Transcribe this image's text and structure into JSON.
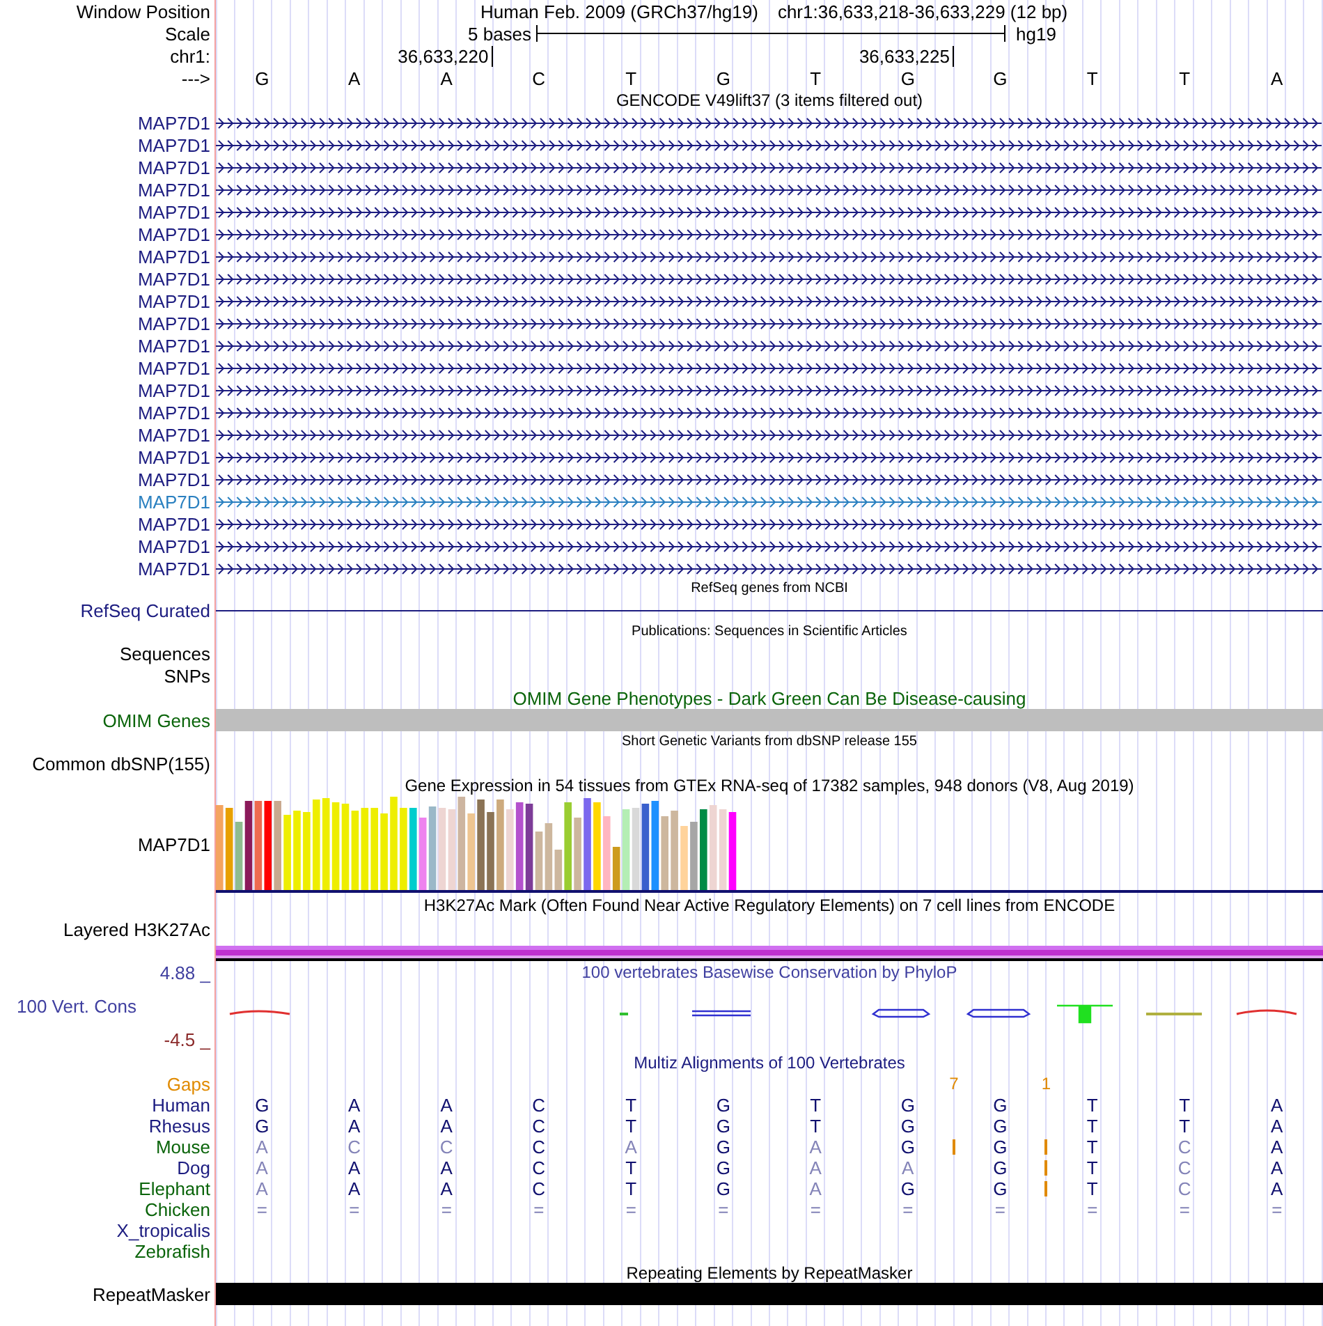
{
  "header": {
    "labels": [
      "Window Position",
      "Scale",
      "chr1:",
      "--->"
    ],
    "assembly": "Human Feb. 2009 (GRCh37/hg19)",
    "position": "chr1:36,633,218-36,633,229 (12 bp)",
    "scale_label": "5 bases",
    "scale_db": "hg19",
    "ticks": [
      "36,633,220",
      "36,633,225"
    ],
    "bases": [
      "G",
      "A",
      "A",
      "C",
      "T",
      "G",
      "T",
      "G",
      "G",
      "T",
      "T",
      "A"
    ]
  },
  "tracks": [
    {
      "kind": "gencode",
      "title": "GENCODE V49lift37 (3 items filtered out)",
      "rows": [
        {
          "label": "MAP7D1",
          "color": "#1c1c80"
        },
        {
          "label": "MAP7D1",
          "color": "#1c1c80"
        },
        {
          "label": "MAP7D1",
          "color": "#1c1c80"
        },
        {
          "label": "MAP7D1",
          "color": "#1c1c80"
        },
        {
          "label": "MAP7D1",
          "color": "#1c1c80"
        },
        {
          "label": "MAP7D1",
          "color": "#1c1c80"
        },
        {
          "label": "MAP7D1",
          "color": "#1c1c80"
        },
        {
          "label": "MAP7D1",
          "color": "#1c1c80"
        },
        {
          "label": "MAP7D1",
          "color": "#1c1c80"
        },
        {
          "label": "MAP7D1",
          "color": "#1c1c80"
        },
        {
          "label": "MAP7D1",
          "color": "#1c1c80"
        },
        {
          "label": "MAP7D1",
          "color": "#1c1c80"
        },
        {
          "label": "MAP7D1",
          "color": "#1c1c80"
        },
        {
          "label": "MAP7D1",
          "color": "#1c1c80"
        },
        {
          "label": "MAP7D1",
          "color": "#1c1c80"
        },
        {
          "label": "MAP7D1",
          "color": "#1c1c80"
        },
        {
          "label": "MAP7D1",
          "color": "#1c1c80"
        },
        {
          "label": "MAP7D1",
          "color": "#2a80c0"
        },
        {
          "label": "MAP7D1",
          "color": "#1c1c80"
        },
        {
          "label": "MAP7D1",
          "color": "#1c1c80"
        },
        {
          "label": "MAP7D1",
          "color": "#1c1c80"
        }
      ]
    },
    {
      "kind": "refseq",
      "title": "RefSeq genes from NCBI",
      "label": "RefSeq Curated"
    },
    {
      "kind": "publications",
      "title": "Publications: Sequences in Scientific Articles",
      "labels": [
        "Sequences",
        "SNPs"
      ]
    },
    {
      "kind": "omim",
      "title": "OMIM Gene Phenotypes - Dark Green Can Be Disease-causing",
      "label": "OMIM Genes"
    },
    {
      "kind": "dbsnp",
      "title": "Short Genetic Variants from dbSNP release 155",
      "label": "Common dbSNP(155)"
    },
    {
      "kind": "gtex",
      "title": "Gene Expression in 54 tissues from GTEx RNA-seq of 17382 samples, 948 donors (V8, Aug 2019)",
      "label": "MAP7D1"
    },
    {
      "kind": "h3k27ac",
      "title": "H3K27Ac Mark (Often Found Near Active Regulatory Elements) on 7 cell lines from ENCODE",
      "label": "Layered H3K27Ac"
    },
    {
      "kind": "phylop",
      "title": "100 vertebrates Basewise Conservation by PhyloP",
      "label": "100 Vert. Cons",
      "max_label": "4.88 _",
      "min_label": "-4.5 _"
    },
    {
      "kind": "multiz",
      "title": "Multiz Alignments of 100 Vertebrates",
      "gaps_label": "Gaps",
      "gaps": [
        {
          "count": "7"
        },
        {
          "count": "1"
        }
      ],
      "species": [
        {
          "name": "Human",
          "color": "#1c1c80",
          "bases": [
            {
              "base": "G",
              "match": true,
              "insert_after": false
            },
            {
              "base": "A",
              "match": true,
              "insert_after": false
            },
            {
              "base": "A",
              "match": true,
              "insert_after": false
            },
            {
              "base": "C",
              "match": true,
              "insert_after": false
            },
            {
              "base": "T",
              "match": true,
              "insert_after": false
            },
            {
              "base": "G",
              "match": true,
              "insert_after": false
            },
            {
              "base": "T",
              "match": true,
              "insert_after": false
            },
            {
              "base": "G",
              "match": true,
              "insert_after": false
            },
            {
              "base": "G",
              "match": true,
              "insert_after": false
            },
            {
              "base": "T",
              "match": true,
              "insert_after": false
            },
            {
              "base": "T",
              "match": true,
              "insert_after": false
            },
            {
              "base": "A",
              "match": true,
              "insert_after": false
            }
          ]
        },
        {
          "name": "Rhesus",
          "color": "#1c1c80",
          "bases": [
            {
              "base": "G",
              "match": true,
              "insert_after": false
            },
            {
              "base": "A",
              "match": true,
              "insert_after": false
            },
            {
              "base": "A",
              "match": true,
              "insert_after": false
            },
            {
              "base": "C",
              "match": true,
              "insert_after": false
            },
            {
              "base": "T",
              "match": true,
              "insert_after": false
            },
            {
              "base": "G",
              "match": true,
              "insert_after": false
            },
            {
              "base": "T",
              "match": true,
              "insert_after": false
            },
            {
              "base": "G",
              "match": true,
              "insert_after": false
            },
            {
              "base": "G",
              "match": true,
              "insert_after": false
            },
            {
              "base": "T",
              "match": true,
              "insert_after": false
            },
            {
              "base": "T",
              "match": true,
              "insert_after": false
            },
            {
              "base": "A",
              "match": true,
              "insert_after": false
            }
          ]
        },
        {
          "name": "Mouse",
          "color": "#0a640a",
          "bases": [
            {
              "base": "A",
              "match": false,
              "insert_after": false
            },
            {
              "base": "C",
              "match": false,
              "insert_after": false
            },
            {
              "base": "C",
              "match": false,
              "insert_after": false
            },
            {
              "base": "C",
              "match": true,
              "insert_after": false
            },
            {
              "base": "A",
              "match": false,
              "insert_after": false
            },
            {
              "base": "G",
              "match": true,
              "insert_after": false
            },
            {
              "base": "A",
              "match": false,
              "insert_after": false
            },
            {
              "base": "G",
              "match": true,
              "insert_after": true
            },
            {
              "base": "G",
              "match": true,
              "insert_after": true
            },
            {
              "base": "T",
              "match": true,
              "insert_after": false
            },
            {
              "base": "C",
              "match": false,
              "insert_after": false
            },
            {
              "base": "A",
              "match": true,
              "insert_after": false
            }
          ]
        },
        {
          "name": "Dog",
          "color": "#1c1c80",
          "bases": [
            {
              "base": "A",
              "match": false,
              "insert_after": false
            },
            {
              "base": "A",
              "match": true,
              "insert_after": false
            },
            {
              "base": "A",
              "match": true,
              "insert_after": false
            },
            {
              "base": "C",
              "match": true,
              "insert_after": false
            },
            {
              "base": "T",
              "match": true,
              "insert_after": false
            },
            {
              "base": "G",
              "match": true,
              "insert_after": false
            },
            {
              "base": "A",
              "match": false,
              "insert_after": false
            },
            {
              "base": "A",
              "match": false,
              "insert_after": false
            },
            {
              "base": "G",
              "match": true,
              "insert_after": true
            },
            {
              "base": "T",
              "match": true,
              "insert_after": false
            },
            {
              "base": "C",
              "match": false,
              "insert_after": false
            },
            {
              "base": "A",
              "match": true,
              "insert_after": false
            }
          ]
        },
        {
          "name": "Elephant",
          "color": "#0a640a",
          "bases": [
            {
              "base": "A",
              "match": false,
              "insert_after": false
            },
            {
              "base": "A",
              "match": true,
              "insert_after": false
            },
            {
              "base": "A",
              "match": true,
              "insert_after": false
            },
            {
              "base": "C",
              "match": true,
              "insert_after": false
            },
            {
              "base": "T",
              "match": true,
              "insert_after": false
            },
            {
              "base": "G",
              "match": true,
              "insert_after": false
            },
            {
              "base": "A",
              "match": false,
              "insert_after": false
            },
            {
              "base": "G",
              "match": true,
              "insert_after": false
            },
            {
              "base": "G",
              "match": true,
              "insert_after": true
            },
            {
              "base": "T",
              "match": true,
              "insert_after": false
            },
            {
              "base": "C",
              "match": false,
              "insert_after": false
            },
            {
              "base": "A",
              "match": true,
              "insert_after": false
            }
          ]
        },
        {
          "name": "Chicken",
          "color": "#0a640a",
          "bases": [
            {
              "base": "=",
              "match": false,
              "insert_after": false
            },
            {
              "base": "=",
              "match": false,
              "insert_after": false
            },
            {
              "base": "=",
              "match": false,
              "insert_after": false
            },
            {
              "base": "=",
              "match": false,
              "insert_after": false
            },
            {
              "base": "=",
              "match": false,
              "insert_after": false
            },
            {
              "base": "=",
              "match": false,
              "insert_after": false
            },
            {
              "base": "=",
              "match": false,
              "insert_after": false
            },
            {
              "base": "=",
              "match": false,
              "insert_after": false
            },
            {
              "base": "=",
              "match": false,
              "insert_after": false
            },
            {
              "base": "=",
              "match": false,
              "insert_after": false
            },
            {
              "base": "=",
              "match": false,
              "insert_after": false
            },
            {
              "base": "=",
              "match": false,
              "insert_after": false
            }
          ]
        },
        {
          "name": "X_tropicalis",
          "color": "#1c1c80"
        },
        {
          "name": "Zebrafish",
          "color": "#0a640a"
        }
      ]
    },
    {
      "kind": "repeatmasker",
      "title": "Repeating Elements by RepeatMasker",
      "label": "RepeatMasker"
    }
  ]
}
